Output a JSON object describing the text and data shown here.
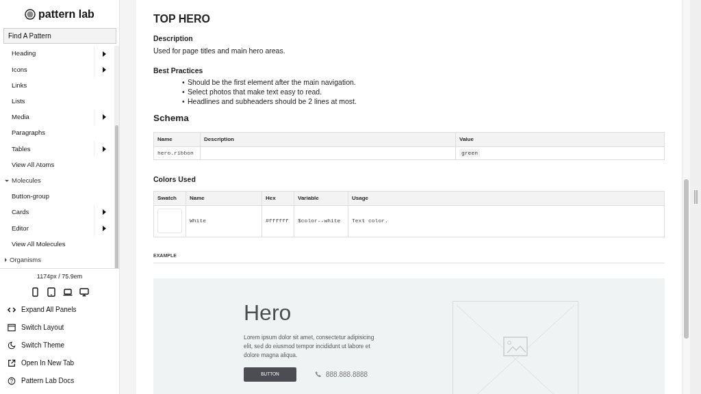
{
  "sidebar": {
    "logo": "pattern lab",
    "search": {
      "placeholder": "Find A Pattern"
    },
    "nav": [
      {
        "kind": "item",
        "label": "Heading",
        "submenu": true
      },
      {
        "kind": "item",
        "label": "Icons",
        "submenu": true
      },
      {
        "kind": "item",
        "label": "Links",
        "submenu": false
      },
      {
        "kind": "item",
        "label": "Lists",
        "submenu": false
      },
      {
        "kind": "item",
        "label": "Media",
        "submenu": true
      },
      {
        "kind": "item",
        "label": "Paragraphs",
        "submenu": false
      },
      {
        "kind": "item",
        "label": "Tables",
        "submenu": true
      },
      {
        "kind": "item",
        "label": "View All Atoms",
        "submenu": false
      },
      {
        "kind": "category",
        "label": "Molecules",
        "expanded": true
      },
      {
        "kind": "item",
        "label": "Button-group",
        "submenu": false
      },
      {
        "kind": "item",
        "label": "Cards",
        "submenu": true
      },
      {
        "kind": "item",
        "label": "Editor",
        "submenu": true
      },
      {
        "kind": "item",
        "label": "View All Molecules",
        "submenu": false
      },
      {
        "kind": "category",
        "label": "Organisms",
        "expanded": false
      }
    ],
    "viewport": "1174px / 75.9em",
    "devices": [
      {
        "kind": "phone"
      },
      {
        "kind": "tablet"
      },
      {
        "kind": "laptop"
      },
      {
        "kind": "desktop"
      }
    ],
    "tools": [
      {
        "kind": "code",
        "label": "Expand All Panels"
      },
      {
        "kind": "layout",
        "label": "Switch Layout"
      },
      {
        "kind": "moon",
        "label": "Switch Theme"
      },
      {
        "kind": "external",
        "label": "Open In New Tab"
      },
      {
        "kind": "help",
        "label": "Pattern Lab Docs"
      }
    ]
  },
  "main": {
    "title": "TOP HERO",
    "description": {
      "heading": "Description",
      "text": "Used for page titles and main hero areas."
    },
    "best_practices": {
      "heading": "Best Practices",
      "items": [
        {
          "marker": "•",
          "text": "Should be the first element after the main navigation."
        },
        {
          "marker": "•",
          "text": "Select photos that make text easy to read."
        },
        {
          "marker": "•",
          "text": "Headlines and subheaders should be 2 lines at most."
        }
      ]
    },
    "schema": {
      "heading": "Schema",
      "columns": [
        "Name",
        "Description",
        "Value"
      ],
      "rows": [
        [
          "hero.ribbon",
          "",
          "green"
        ]
      ]
    },
    "colors": {
      "heading": "Colors Used",
      "columns": [
        "Swatch",
        "Name",
        "Hex",
        "Variable",
        "Usage"
      ],
      "rows": [
        {
          "color": "#ffffff",
          "name": "White",
          "hex": "#ffffff",
          "variable": "$color--white",
          "usage": "Text color."
        }
      ]
    },
    "example_label": "EXAMPLE",
    "hero": {
      "title": "Hero",
      "text": "Lorem ipsum dolor sit amet, consectetur adipisicing elit, sed do eiusmod tempor incididunt ut labore et dolore magna aliqua.",
      "button": "BUTTON",
      "phone": "888.888.8888"
    }
  }
}
